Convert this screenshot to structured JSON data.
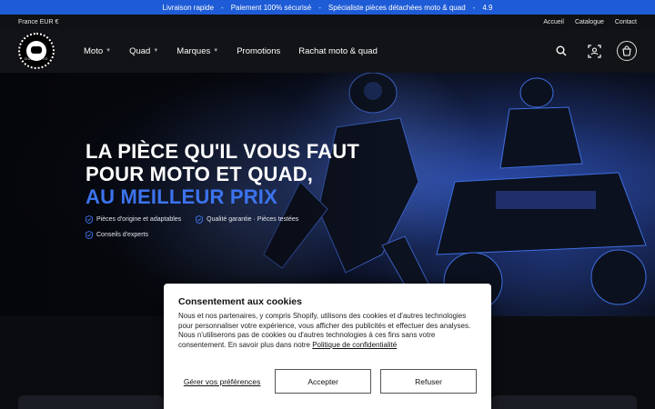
{
  "announcement": {
    "items": [
      "Livraison rapide",
      "Paiement 100% sécurisé",
      "Spécialiste pièces détachées moto & quad",
      "4.9"
    ],
    "separator": "-"
  },
  "utility": {
    "currency": "France EUR €",
    "links": [
      "Accueil",
      "Catalogue",
      "Contact"
    ]
  },
  "logo": {
    "text": "DUB MOTO"
  },
  "nav": [
    {
      "label": "Moto",
      "has_dropdown": true
    },
    {
      "label": "Quad",
      "has_dropdown": true
    },
    {
      "label": "Marques",
      "has_dropdown": true
    },
    {
      "label": "Promotions",
      "has_dropdown": false
    },
    {
      "label": "Rachat moto & quad",
      "has_dropdown": false
    }
  ],
  "header_icons": [
    "search-icon",
    "account-scan-icon",
    "cart-icon"
  ],
  "hero": {
    "line1": "LA PIÈCE QU'IL VOUS FAUT",
    "line2": "POUR MOTO ET QUAD,",
    "line3": "AU MEILLEUR PRIX",
    "badges": [
      "Pièces d'origine et adaptables",
      "Qualité garantie · Pièces testées",
      "Conseils d'experts"
    ]
  },
  "cookie": {
    "title": "Consentement aux cookies",
    "body": "Nous et nos partenaires, y compris Shopify, utilisons des cookies et d'autres technologies pour personnaliser votre expérience, vous afficher des publicités et effectuer des analyses. Nous n'utiliserons pas de cookies ou d'autres technologies à ces fins sans votre consentement. En savoir plus dans notre",
    "policy_link": "Politique de confidentialité",
    "manage": "Gérer vos préférences",
    "accept": "Accepter",
    "refuse": "Refuser"
  },
  "colors": {
    "accent": "#1e5bd6",
    "headline_accent": "#3c73ee",
    "header_bg": "#121317"
  }
}
